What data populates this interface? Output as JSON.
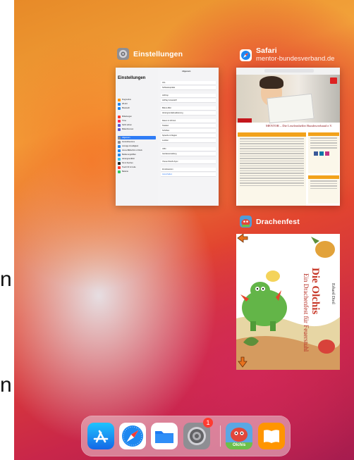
{
  "switcher": {
    "settings": {
      "app_name": "Einstellungen"
    },
    "safari": {
      "app_name": "Safari",
      "domain": "mentor-bundesverband.de"
    },
    "game": {
      "app_name": "Drachenfest"
    }
  },
  "settings_card": {
    "sidebar_title": "Einstellungen",
    "pane_title": "Allgemein",
    "sidebar_items": [
      "Flugmodus",
      "WLAN",
      "Bluetooth",
      "Mitteilungen",
      "Töne",
      "Nicht stören",
      "Bildschirmzeit",
      "Allgemein",
      "Kontrollzentrum",
      "Anzeige & Helligkeit",
      "Home-Bildschirm & Dock",
      "Bedienungshilfen",
      "Hintergrundbild",
      "Siri & Suchen",
      "Touch ID & Code",
      "Batterie"
    ],
    "pane_rows": [
      "Info",
      "Softwareupdate",
      "AirDrop",
      "AirPlay & Handoff",
      "Bild-in-Bild",
      "Hintergrundaktualisierung",
      "Datum & Uhrzeit",
      "Tastatur",
      "Schriften",
      "Sprache & Region",
      "Lexikon",
      "VPN",
      "Geräteverwaltung",
      "iTunes WLAN-Sync",
      "Zurücksetzen",
      "Ausschalten"
    ]
  },
  "safari_card": {
    "tagline": "MENTOR – Die Leselernhelfer Bundesverband e.V."
  },
  "game_card": {
    "title_line1": "Die Olchis",
    "title_line2": "Ein Drachenfest für Feuerstuhl",
    "author": "Erhard Dietl"
  },
  "dock": {
    "badge": "1",
    "apps": [
      "app-store",
      "safari",
      "files",
      "settings",
      "olchis",
      "books"
    ],
    "olchis_label": "Olchis"
  },
  "colors": {
    "accent_blue": "#2f7cf6",
    "wallpaper_orange": "#f2a23a",
    "wallpaper_red": "#e2452f",
    "wallpaper_magenta": "#c8264a",
    "badge_red": "#ff3b30"
  }
}
